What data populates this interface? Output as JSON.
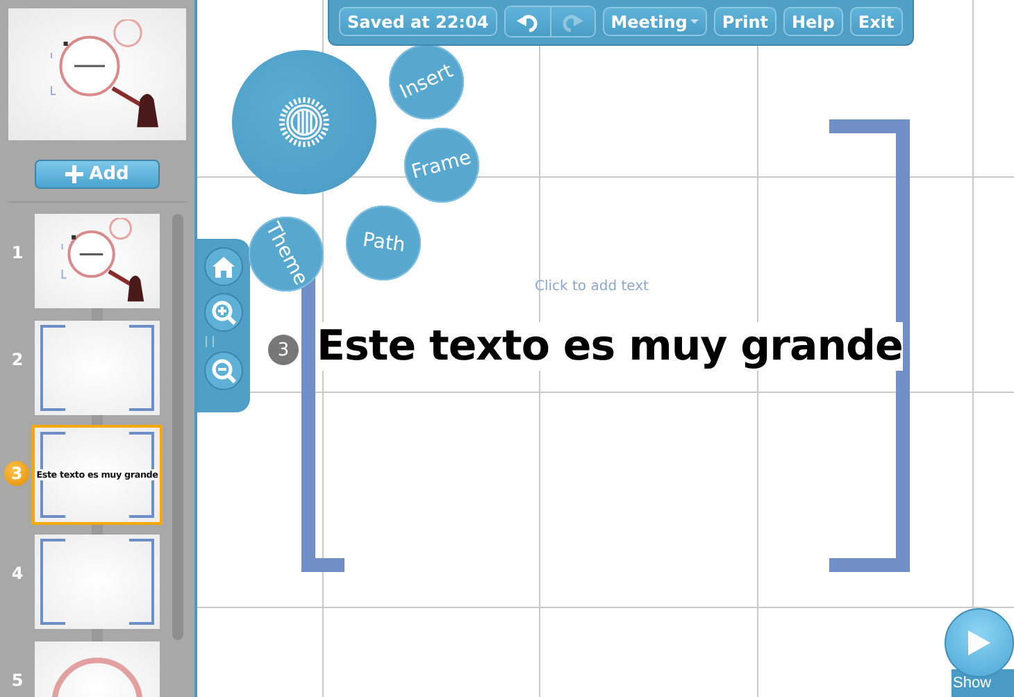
{
  "toolbar": {
    "status": "Saved at 22:04",
    "undo": {
      "disabled": false
    },
    "redo": {
      "disabled": true
    },
    "buttons": [
      {
        "label": "Meeting",
        "kind": "dropdown"
      },
      {
        "label": "Print",
        "kind": "plain"
      },
      {
        "label": "Help",
        "kind": "plain"
      },
      {
        "label": "Exit",
        "kind": "plain"
      }
    ]
  },
  "sidebar": {
    "add_button": "Add",
    "slides": [
      {
        "number": "1",
        "selected": false,
        "kind": "overview"
      },
      {
        "number": "2",
        "selected": false,
        "kind": "frame"
      },
      {
        "number": "3",
        "selected": true,
        "kind": "frame",
        "title": "Este texto es muy grande"
      },
      {
        "number": "4",
        "selected": false,
        "kind": "frame"
      },
      {
        "number": "5",
        "selected": false,
        "kind": "circle"
      }
    ]
  },
  "bubble_menu": {
    "items": [
      "Insert",
      "Frame",
      "Path",
      "Theme"
    ]
  },
  "canvas": {
    "placeholder": "Click to add text",
    "step": "3",
    "text": "Este texto es muy grande"
  },
  "show_button": "Show"
}
